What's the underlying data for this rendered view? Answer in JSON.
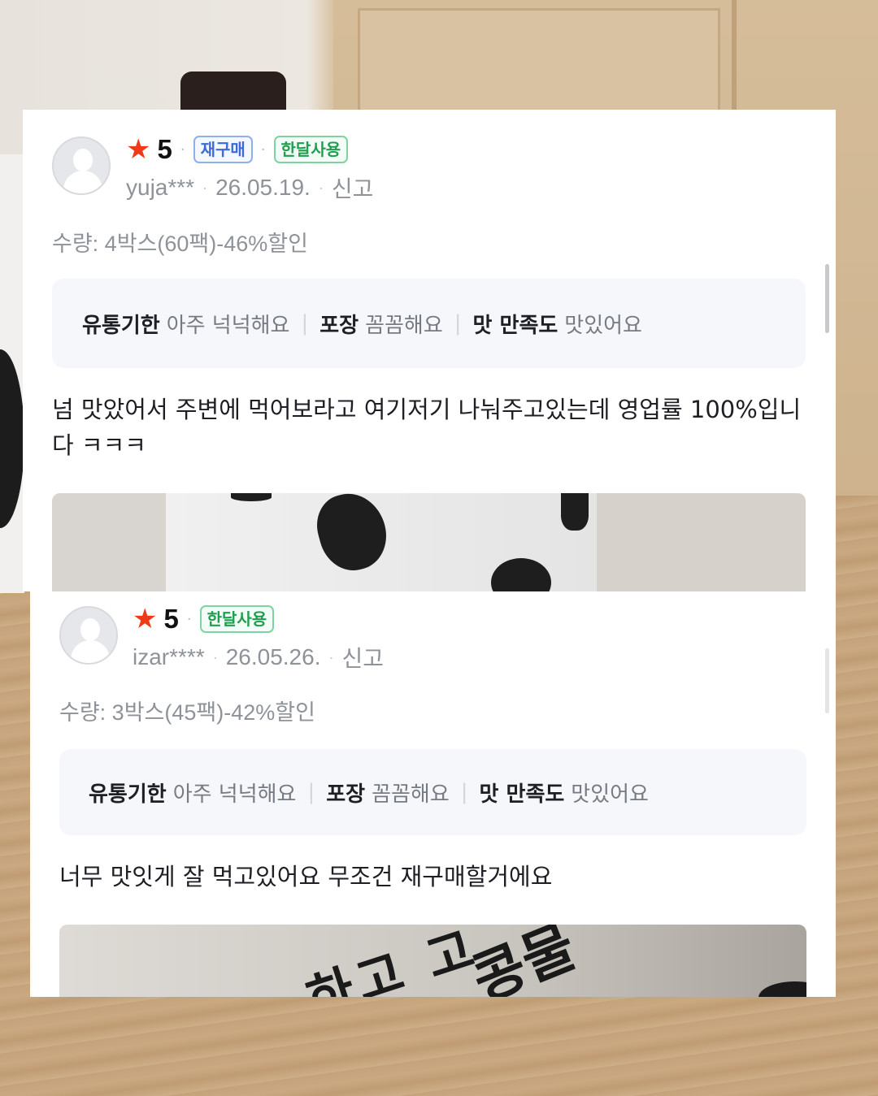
{
  "reviews": [
    {
      "rating": "5",
      "badges": [
        "재구매",
        "한달사용"
      ],
      "username": "yuja***",
      "date": "26.05.19.",
      "report_label": "신고",
      "option": "수량: 4박스(60팩)-46%할인",
      "summary": [
        {
          "key": "유통기한",
          "value": "아주 넉넉해요"
        },
        {
          "key": "포장",
          "value": "꼼꼼해요"
        },
        {
          "key": "맛 만족도",
          "value": "맛있어요"
        }
      ],
      "text": "넘 맛았어서 주변에 먹어보라고 여기저기 나눠주고있는데 영업률 100%입니다 ㅋㅋㅋ"
    },
    {
      "rating": "5",
      "badges": [
        "한달사용"
      ],
      "username": "izar****",
      "date": "26.05.26.",
      "report_label": "신고",
      "option": "수량: 3박스(45팩)-42%할인",
      "summary": [
        {
          "key": "유통기한",
          "value": "아주 넉넉해요"
        },
        {
          "key": "포장",
          "value": "꼼꼼해요"
        },
        {
          "key": "맛 만족도",
          "value": "맛있어요"
        }
      ],
      "text": "너무 맛잇게 잘 먹고있어요 무조건 재구매할거에요",
      "photo_text": [
        "하고 고",
        "콩물"
      ]
    }
  ],
  "icons": {
    "star": "star-icon",
    "avatar": "default-avatar-icon"
  },
  "colors": {
    "star": "#f03a17",
    "badge_blue": "#3c6ad8",
    "badge_green": "#1f9e4f"
  }
}
